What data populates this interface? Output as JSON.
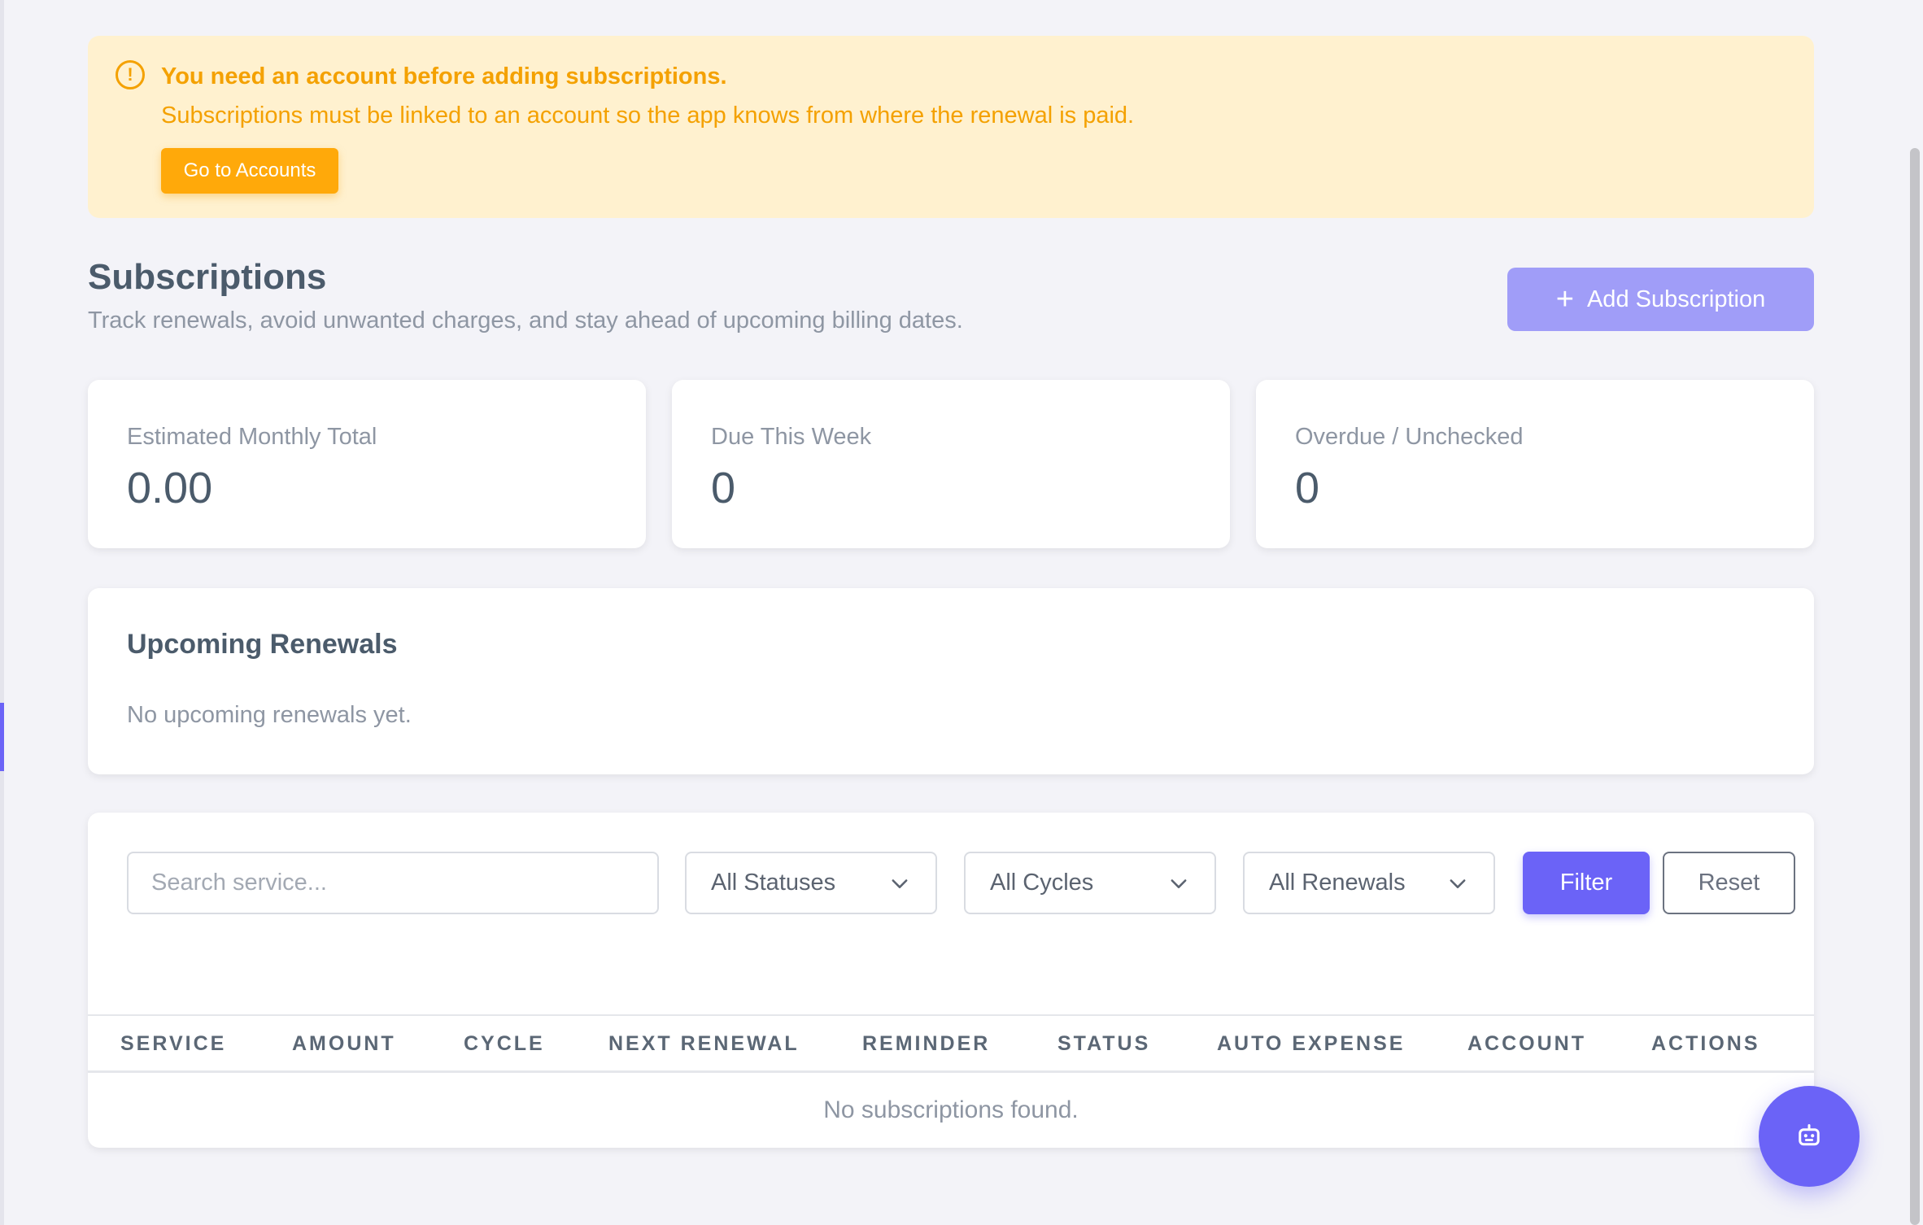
{
  "alert": {
    "title": "You need an account before adding subscriptions.",
    "message": "Subscriptions must be linked to an account so the app knows from where the renewal is paid.",
    "button_label": "Go to Accounts",
    "icon": "exclamation-circle-icon",
    "color": "#f4a100"
  },
  "header": {
    "title": "Subscriptions",
    "subtitle": "Track renewals, avoid unwanted charges, and stay ahead of upcoming billing dates.",
    "add_button_label": "Add Subscription",
    "add_button_icon": "+"
  },
  "stats": [
    {
      "label": "Estimated Monthly Total",
      "value": "0.00"
    },
    {
      "label": "Due This Week",
      "value": "0"
    },
    {
      "label": "Overdue / Unchecked",
      "value": "0"
    }
  ],
  "renewals": {
    "title": "Upcoming Renewals",
    "empty_text": "No upcoming renewals yet."
  },
  "filters": {
    "search_placeholder": "Search service...",
    "status_selected": "All Statuses",
    "cycle_selected": "All Cycles",
    "renewal_selected": "All Renewals",
    "filter_label": "Filter",
    "reset_label": "Reset"
  },
  "table": {
    "columns": [
      "SERVICE",
      "AMOUNT",
      "CYCLE",
      "NEXT RENEWAL",
      "REMINDER",
      "STATUS",
      "AUTO EXPENSE",
      "ACCOUNT",
      "ACTIONS"
    ],
    "empty_text": "No subscriptions found."
  },
  "fab": {
    "icon": "robot-icon"
  },
  "colors": {
    "accent": "#6b63f7",
    "warning": "#f4a100",
    "background": "#f3f3f8"
  }
}
